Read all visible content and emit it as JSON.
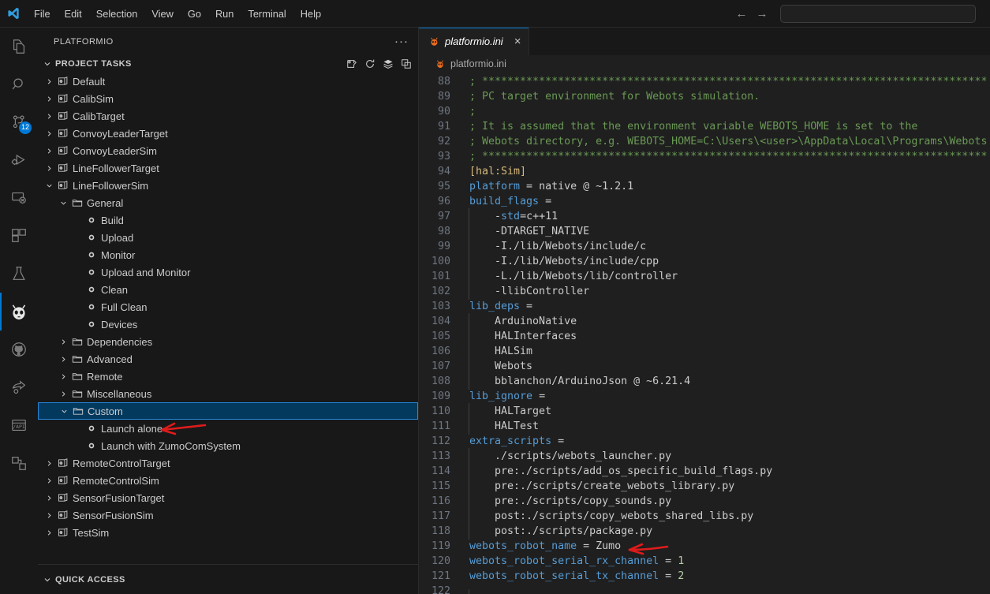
{
  "window": {
    "menu": [
      "File",
      "Edit",
      "Selection",
      "View",
      "Go",
      "Run",
      "Terminal",
      "Help"
    ],
    "nav_back": "←",
    "nav_forward": "→",
    "command_center_placeholder": ""
  },
  "activity_bar": {
    "items": [
      {
        "name": "explorer-icon",
        "badge": ""
      },
      {
        "name": "search-icon",
        "badge": ""
      },
      {
        "name": "source-control-icon",
        "badge": "12"
      },
      {
        "name": "run-and-debug-icon",
        "badge": ""
      },
      {
        "name": "remote-explorer-icon",
        "badge": ""
      },
      {
        "name": "extensions-icon",
        "badge": ""
      },
      {
        "name": "testing-icon",
        "badge": ""
      },
      {
        "name": "platformio-icon",
        "badge": ""
      },
      {
        "name": "github-icon",
        "badge": ""
      },
      {
        "name": "live-share-icon",
        "badge": ""
      },
      {
        "name": "thunder-client-api-icon",
        "badge": ""
      },
      {
        "name": "dependency-graph-icon",
        "badge": ""
      }
    ]
  },
  "sidebar": {
    "title": "PLATFORMIO",
    "more_actions": "···",
    "project_tasks": {
      "label": "PROJECT TASKS",
      "header_icons": [
        "new-terminal-icon",
        "refresh-icon",
        "layers-icon",
        "collapse-all-icon"
      ]
    },
    "quick_access": {
      "label": "QUICK ACCESS"
    },
    "tree": [
      {
        "label": "Default",
        "kind": "env",
        "indent": 1,
        "state": "collapsed",
        "selected": false
      },
      {
        "label": "CalibSim",
        "kind": "env",
        "indent": 1,
        "state": "collapsed",
        "selected": false
      },
      {
        "label": "CalibTarget",
        "kind": "env",
        "indent": 1,
        "state": "collapsed",
        "selected": false
      },
      {
        "label": "ConvoyLeaderTarget",
        "kind": "env",
        "indent": 1,
        "state": "collapsed",
        "selected": false
      },
      {
        "label": "ConvoyLeaderSim",
        "kind": "env",
        "indent": 1,
        "state": "collapsed",
        "selected": false
      },
      {
        "label": "LineFollowerTarget",
        "kind": "env",
        "indent": 1,
        "state": "collapsed",
        "selected": false
      },
      {
        "label": "LineFollowerSim",
        "kind": "env",
        "indent": 1,
        "state": "expanded",
        "selected": false
      },
      {
        "label": "General",
        "kind": "folder",
        "indent": 2,
        "state": "expanded",
        "selected": false
      },
      {
        "label": "Build",
        "kind": "task",
        "indent": 3,
        "state": "leaf",
        "selected": false
      },
      {
        "label": "Upload",
        "kind": "task",
        "indent": 3,
        "state": "leaf",
        "selected": false
      },
      {
        "label": "Monitor",
        "kind": "task",
        "indent": 3,
        "state": "leaf",
        "selected": false
      },
      {
        "label": "Upload and Monitor",
        "kind": "task",
        "indent": 3,
        "state": "leaf",
        "selected": false
      },
      {
        "label": "Clean",
        "kind": "task",
        "indent": 3,
        "state": "leaf",
        "selected": false
      },
      {
        "label": "Full Clean",
        "kind": "task",
        "indent": 3,
        "state": "leaf",
        "selected": false
      },
      {
        "label": "Devices",
        "kind": "task",
        "indent": 3,
        "state": "leaf",
        "selected": false
      },
      {
        "label": "Dependencies",
        "kind": "folder",
        "indent": 2,
        "state": "collapsed",
        "selected": false
      },
      {
        "label": "Advanced",
        "kind": "folder",
        "indent": 2,
        "state": "collapsed",
        "selected": false
      },
      {
        "label": "Remote",
        "kind": "folder",
        "indent": 2,
        "state": "collapsed",
        "selected": false
      },
      {
        "label": "Miscellaneous",
        "kind": "folder",
        "indent": 2,
        "state": "collapsed",
        "selected": false
      },
      {
        "label": "Custom",
        "kind": "folder",
        "indent": 2,
        "state": "expanded",
        "selected": true
      },
      {
        "label": "Launch alone",
        "kind": "task",
        "indent": 3,
        "state": "leaf",
        "selected": false
      },
      {
        "label": "Launch with ZumoComSystem",
        "kind": "task",
        "indent": 3,
        "state": "leaf",
        "selected": false
      },
      {
        "label": "RemoteControlTarget",
        "kind": "env",
        "indent": 1,
        "state": "collapsed",
        "selected": false
      },
      {
        "label": "RemoteControlSim",
        "kind": "env",
        "indent": 1,
        "state": "collapsed",
        "selected": false
      },
      {
        "label": "SensorFusionTarget",
        "kind": "env",
        "indent": 1,
        "state": "collapsed",
        "selected": false
      },
      {
        "label": "SensorFusionSim",
        "kind": "env",
        "indent": 1,
        "state": "collapsed",
        "selected": false
      },
      {
        "label": "TestSim",
        "kind": "env",
        "indent": 1,
        "state": "collapsed",
        "selected": false
      }
    ]
  },
  "editor": {
    "tab": {
      "label": "platformio.ini",
      "close": "×",
      "icon": "platformio-file-icon"
    },
    "breadcrumb": {
      "label": "platformio.ini",
      "icon": "platformio-file-icon"
    },
    "first_line_number": 88,
    "lines": [
      {
        "n": 88,
        "indent": false,
        "tokens": [
          {
            "t": "; ********************************************************************************",
            "c": "c-comment"
          }
        ]
      },
      {
        "n": 89,
        "indent": false,
        "tokens": [
          {
            "t": "; PC target environment for Webots simulation.",
            "c": "c-comment"
          }
        ]
      },
      {
        "n": 90,
        "indent": false,
        "tokens": [
          {
            "t": ";",
            "c": "c-comment"
          }
        ]
      },
      {
        "n": 91,
        "indent": false,
        "tokens": [
          {
            "t": "; It is assumed that the environment variable WEBOTS_HOME is set to the",
            "c": "c-comment"
          }
        ]
      },
      {
        "n": 92,
        "indent": false,
        "tokens": [
          {
            "t": "; Webots directory, e.g. WEBOTS_HOME=C:\\Users\\<user>\\AppData\\Local\\Programs\\Webots",
            "c": "c-comment"
          }
        ]
      },
      {
        "n": 93,
        "indent": false,
        "tokens": [
          {
            "t": "; ********************************************************************************",
            "c": "c-comment"
          }
        ]
      },
      {
        "n": 94,
        "indent": false,
        "tokens": [
          {
            "t": "[hal:Sim]",
            "c": "c-section"
          }
        ]
      },
      {
        "n": 95,
        "indent": false,
        "tokens": [
          {
            "t": "platform",
            "c": "c-key"
          },
          {
            "t": " = native @ ~1.2.1",
            "c": "c-val"
          }
        ]
      },
      {
        "n": 96,
        "indent": false,
        "tokens": [
          {
            "t": "build_flags",
            "c": "c-key"
          },
          {
            "t": " =",
            "c": "c-val"
          }
        ]
      },
      {
        "n": 97,
        "indent": true,
        "tokens": [
          {
            "t": "    -",
            "c": "c-val"
          },
          {
            "t": "std",
            "c": "c-key"
          },
          {
            "t": "=c++11",
            "c": "c-val"
          }
        ]
      },
      {
        "n": 98,
        "indent": true,
        "tokens": [
          {
            "t": "    -DTARGET_NATIVE",
            "c": "c-val"
          }
        ]
      },
      {
        "n": 99,
        "indent": true,
        "tokens": [
          {
            "t": "    -I./lib/Webots/include/c",
            "c": "c-val"
          }
        ]
      },
      {
        "n": 100,
        "indent": true,
        "tokens": [
          {
            "t": "    -I./lib/Webots/include/cpp",
            "c": "c-val"
          }
        ]
      },
      {
        "n": 101,
        "indent": true,
        "tokens": [
          {
            "t": "    -L./lib/Webots/lib/controller",
            "c": "c-val"
          }
        ]
      },
      {
        "n": 102,
        "indent": true,
        "tokens": [
          {
            "t": "    -llibController",
            "c": "c-val"
          }
        ]
      },
      {
        "n": 103,
        "indent": false,
        "tokens": [
          {
            "t": "lib_deps",
            "c": "c-key"
          },
          {
            "t": " =",
            "c": "c-val"
          }
        ]
      },
      {
        "n": 104,
        "indent": true,
        "tokens": [
          {
            "t": "    ArduinoNative",
            "c": "c-val"
          }
        ]
      },
      {
        "n": 105,
        "indent": true,
        "tokens": [
          {
            "t": "    HALInterfaces",
            "c": "c-val"
          }
        ]
      },
      {
        "n": 106,
        "indent": true,
        "tokens": [
          {
            "t": "    HALSim",
            "c": "c-val"
          }
        ]
      },
      {
        "n": 107,
        "indent": true,
        "tokens": [
          {
            "t": "    Webots",
            "c": "c-val"
          }
        ]
      },
      {
        "n": 108,
        "indent": true,
        "tokens": [
          {
            "t": "    bblanchon/ArduinoJson @ ~6.21.4",
            "c": "c-val"
          }
        ]
      },
      {
        "n": 109,
        "indent": false,
        "tokens": [
          {
            "t": "lib_ignore",
            "c": "c-key"
          },
          {
            "t": " =",
            "c": "c-val"
          }
        ]
      },
      {
        "n": 110,
        "indent": true,
        "tokens": [
          {
            "t": "    HALTarget",
            "c": "c-val"
          }
        ]
      },
      {
        "n": 111,
        "indent": true,
        "tokens": [
          {
            "t": "    HALTest",
            "c": "c-val"
          }
        ]
      },
      {
        "n": 112,
        "indent": false,
        "tokens": [
          {
            "t": "extra_scripts",
            "c": "c-key"
          },
          {
            "t": " =",
            "c": "c-val"
          }
        ]
      },
      {
        "n": 113,
        "indent": true,
        "tokens": [
          {
            "t": "    ./scripts/webots_launcher.py",
            "c": "c-val"
          }
        ]
      },
      {
        "n": 114,
        "indent": true,
        "tokens": [
          {
            "t": "    pre:./scripts/add_os_specific_build_flags.py",
            "c": "c-val"
          }
        ]
      },
      {
        "n": 115,
        "indent": true,
        "tokens": [
          {
            "t": "    pre:./scripts/create_webots_library.py",
            "c": "c-val"
          }
        ]
      },
      {
        "n": 116,
        "indent": true,
        "tokens": [
          {
            "t": "    pre:./scripts/copy_sounds.py",
            "c": "c-val"
          }
        ]
      },
      {
        "n": 117,
        "indent": true,
        "tokens": [
          {
            "t": "    post:./scripts/copy_webots_shared_libs.py",
            "c": "c-val"
          }
        ]
      },
      {
        "n": 118,
        "indent": true,
        "tokens": [
          {
            "t": "    post:./scripts/package.py",
            "c": "c-val"
          }
        ]
      },
      {
        "n": 119,
        "indent": false,
        "tokens": [
          {
            "t": "webots_robot_name",
            "c": "c-key"
          },
          {
            "t": " = Zumo",
            "c": "c-val"
          }
        ]
      },
      {
        "n": 120,
        "indent": false,
        "tokens": [
          {
            "t": "webots_robot_serial_rx_channel",
            "c": "c-key"
          },
          {
            "t": " = ",
            "c": "c-val"
          },
          {
            "t": "1",
            "c": "c-num"
          }
        ]
      },
      {
        "n": 121,
        "indent": false,
        "tokens": [
          {
            "t": "webots_robot_serial_tx_channel",
            "c": "c-key"
          },
          {
            "t": " = ",
            "c": "c-val"
          },
          {
            "t": "2",
            "c": "c-num"
          }
        ]
      },
      {
        "n": 122,
        "indent": true,
        "tokens": [
          {
            "t": "",
            "c": "c-val"
          }
        ]
      }
    ]
  },
  "annotations": [
    {
      "name": "arrow-launch-alone",
      "color": "#e01b1b",
      "points_to": "Launch alone"
    },
    {
      "name": "arrow-webots-robot-name",
      "color": "#e01b1b",
      "points_to": "webots_robot_name = Zumo"
    }
  ],
  "colors": {
    "accent": "#0078d4",
    "selection": "#04395e",
    "selection_border": "#2488db",
    "editor_bg": "#1f1f1f",
    "chrome_bg": "#181818",
    "annotation_red": "#e01b1b"
  }
}
